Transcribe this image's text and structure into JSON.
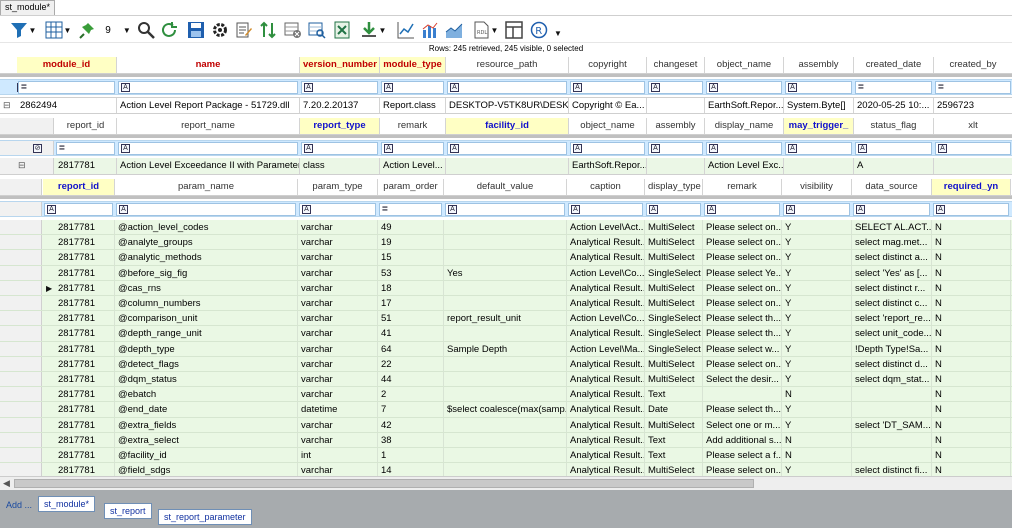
{
  "window": {
    "tab_title": "st_module*"
  },
  "toolbar": {
    "row_limit": "9"
  },
  "status_text": "Rows: 245 retrieved, 245 visible, 0 selected",
  "module": {
    "columns": [
      {
        "label": "module_id",
        "kind": "keyred",
        "w": 100,
        "filter": "eq"
      },
      {
        "label": "name",
        "kind": "req",
        "w": 183,
        "filter": "A"
      },
      {
        "label": "version_number",
        "kind": "keyred",
        "w": 80,
        "filter": "A"
      },
      {
        "label": "module_type",
        "kind": "keyred",
        "w": 66,
        "filter": "A"
      },
      {
        "label": "resource_path",
        "kind": "",
        "w": 123,
        "filter": "A"
      },
      {
        "label": "copyright",
        "kind": "",
        "w": 78,
        "filter": "A"
      },
      {
        "label": "changeset",
        "kind": "",
        "w": 58,
        "filter": "A"
      },
      {
        "label": "object_name",
        "kind": "",
        "w": 79,
        "filter": "A"
      },
      {
        "label": "assembly",
        "kind": "",
        "w": 70,
        "filter": "A"
      },
      {
        "label": "created_date",
        "kind": "",
        "w": 80,
        "filter": "eq"
      },
      {
        "label": "created_by",
        "kind": "",
        "w": 79,
        "filter": "eq"
      }
    ],
    "row": [
      "2862494",
      "Action Level Report Package - 51729.dll",
      "7.20.2.20137",
      "Report.class",
      "DESKTOP-V5TK8UR\\DESKT...",
      "Copyright © Ea...",
      "",
      "EarthSoft.Repor...",
      "System.Byte[]",
      "2020-05-25 10:...",
      "2596723"
    ]
  },
  "report": {
    "columns": [
      {
        "label": "report_id",
        "kind": "",
        "w": 62,
        "filter": "eq"
      },
      {
        "label": "report_name",
        "kind": "",
        "w": 183,
        "filter": "A"
      },
      {
        "label": "report_type",
        "kind": "key",
        "w": 80,
        "filter": "A"
      },
      {
        "label": "remark",
        "kind": "",
        "w": 66,
        "filter": "A"
      },
      {
        "label": "facility_id",
        "kind": "key",
        "w": 123,
        "filter": "A"
      },
      {
        "label": "object_name",
        "kind": "",
        "w": 78,
        "filter": "A"
      },
      {
        "label": "assembly",
        "kind": "",
        "w": 58,
        "filter": "A"
      },
      {
        "label": "display_name",
        "kind": "",
        "w": 79,
        "filter": "A"
      },
      {
        "label": "may_trigger_",
        "kind": "key",
        "w": 70,
        "filter": "A"
      },
      {
        "label": "status_flag",
        "kind": "",
        "w": 80,
        "filter": "A"
      },
      {
        "label": "xlt",
        "kind": "",
        "w": 79,
        "filter": "A"
      }
    ],
    "row": [
      "2817781",
      "Action Level Exceedance II with Parameters",
      "class",
      "Action Level...",
      "",
      "EarthSoft.Repor...",
      "",
      "Action Level Exc...",
      "",
      "A",
      ""
    ]
  },
  "params": {
    "columns": [
      {
        "label": "report_id",
        "kind": "key",
        "w": 72,
        "filter": "A"
      },
      {
        "label": "param_name",
        "kind": "",
        "w": 183,
        "filter": "A"
      },
      {
        "label": "param_type",
        "kind": "",
        "w": 80,
        "filter": "A"
      },
      {
        "label": "param_order",
        "kind": "",
        "w": 66,
        "filter": "eq"
      },
      {
        "label": "default_value",
        "kind": "",
        "w": 123,
        "filter": "A"
      },
      {
        "label": "caption",
        "kind": "",
        "w": 78,
        "filter": "A"
      },
      {
        "label": "display_type",
        "kind": "",
        "w": 58,
        "filter": "A"
      },
      {
        "label": "remark",
        "kind": "",
        "w": 79,
        "filter": "A"
      },
      {
        "label": "visibility",
        "kind": "",
        "w": 70,
        "filter": "A"
      },
      {
        "label": "data_source",
        "kind": "",
        "w": 80,
        "filter": "A"
      },
      {
        "label": "required_yn",
        "kind": "key",
        "w": 79,
        "filter": "A"
      }
    ],
    "current_row": 4,
    "rows": [
      [
        "2817781",
        "@action_level_codes",
        "varchar",
        "49",
        "",
        "Action Level\\Act...",
        "MultiSelect",
        "Please select on...",
        "Y",
        "SELECT AL.ACT...",
        "N"
      ],
      [
        "2817781",
        "@analyte_groups",
        "varchar",
        "19",
        "",
        "Analytical Result...",
        "MultiSelect",
        "Please select on...",
        "Y",
        "select mag.met...",
        "N"
      ],
      [
        "2817781",
        "@analytic_methods",
        "varchar",
        "15",
        "",
        "Analytical Result...",
        "MultiSelect",
        "Please select on...",
        "Y",
        "select distinct a...",
        "N"
      ],
      [
        "2817781",
        "@before_sig_fig",
        "varchar",
        "53",
        "Yes",
        "Action Level\\Co...",
        "SingleSelect",
        "Please select Ye...",
        "Y",
        "select 'Yes' as [...",
        "N"
      ],
      [
        "2817781",
        "@cas_rns",
        "varchar",
        "18",
        "",
        "Analytical Result...",
        "MultiSelect",
        "Please select on...",
        "Y",
        "select distinct r...",
        "N"
      ],
      [
        "2817781",
        "@column_numbers",
        "varchar",
        "17",
        "",
        "Analytical Result...",
        "MultiSelect",
        "Please select on...",
        "Y",
        "select distinct c...",
        "N"
      ],
      [
        "2817781",
        "@comparison_unit",
        "varchar",
        "51",
        "report_result_unit",
        "Action Level\\Co...",
        "SingleSelect",
        "Please select th...",
        "Y",
        "select 'report_re...",
        "N"
      ],
      [
        "2817781",
        "@depth_range_unit",
        "varchar",
        "41",
        "",
        "Analytical Result...",
        "SingleSelect",
        "Please select th...",
        "Y",
        "select unit_code...",
        "N"
      ],
      [
        "2817781",
        "@depth_type",
        "varchar",
        "64",
        "Sample Depth",
        "Action Level\\Ma...",
        "SingleSelect",
        "Please select w...",
        "Y",
        "!Depth Type!Sa...",
        "N"
      ],
      [
        "2817781",
        "@detect_flags",
        "varchar",
        "22",
        "",
        "Analytical Result...",
        "MultiSelect",
        "Please select on...",
        "Y",
        "select distinct d...",
        "N"
      ],
      [
        "2817781",
        "@dqm_status",
        "varchar",
        "44",
        "",
        "Analytical Result...",
        "MultiSelect",
        "Select the desir...",
        "Y",
        "select dqm_stat...",
        "N"
      ],
      [
        "2817781",
        "@ebatch",
        "varchar",
        "2",
        "",
        "Analytical Result...",
        "Text",
        "",
        "N",
        "",
        "N"
      ],
      [
        "2817781",
        "@end_date",
        "datetime",
        "7",
        "$select coalesce(max(samp...",
        "Analytical Result...",
        "Date",
        "Please select th...",
        "Y",
        "",
        "N"
      ],
      [
        "2817781",
        "@extra_fields",
        "varchar",
        "42",
        "",
        "Analytical Result...",
        "MultiSelect",
        "Select one or m...",
        "Y",
        "select 'DT_SAM...",
        "N"
      ],
      [
        "2817781",
        "@extra_select",
        "varchar",
        "38",
        "",
        "Analytical Result...",
        "Text",
        "Add additional s...",
        "N",
        "",
        "N"
      ],
      [
        "2817781",
        "@facility_id",
        "int",
        "1",
        "",
        "Analytical Result...",
        "Text",
        "Please select a f...",
        "N",
        "",
        "N"
      ],
      [
        "2817781",
        "@field_sdgs",
        "varchar",
        "14",
        "",
        "Analytical Result...",
        "MultiSelect",
        "Please select on...",
        "Y",
        "select distinct fi...",
        "N"
      ]
    ]
  },
  "bottom": {
    "add_label": "Add ...",
    "tabs": [
      "st_module*",
      "st_report",
      "st_report_parameter"
    ]
  }
}
